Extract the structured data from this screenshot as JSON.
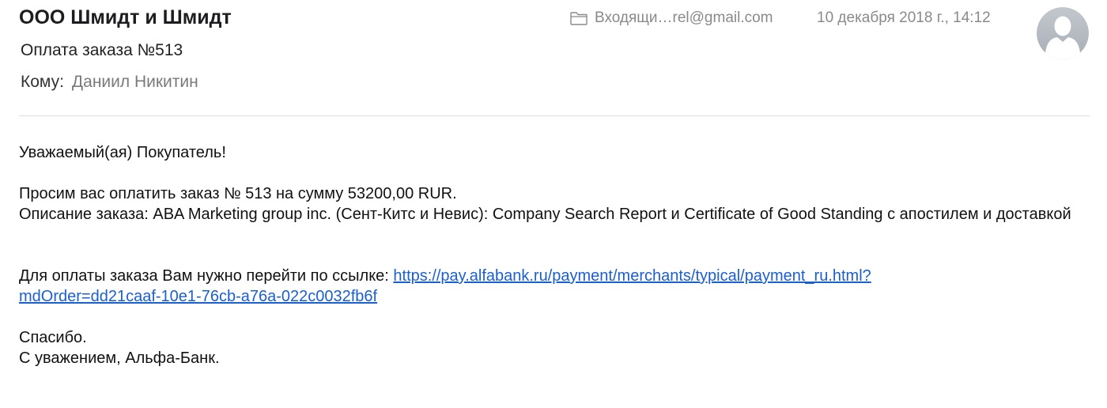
{
  "header": {
    "sender": "ООО Шмидт и Шмидт",
    "subject": "Оплата заказа №513",
    "to_label": "Кому:",
    "to_value": "Даниил Никитин",
    "mailbox": "Входящи…rel@gmail.com",
    "date": "10 декабря 2018 г., 14:12"
  },
  "message": {
    "greeting": "Уважаемый(ая) Покупатель!",
    "request_line": "Просим вас оплатить заказ № 513 на сумму 53200,00 RUR.",
    "description": "Описание заказа: ABA Marketing group inc. (Сент-Китс и Невис): Company Search Report и Certificate of Good Standing с апостилем и доставкой",
    "payment_prefix": "Для оплаты заказа Вам нужно перейти по ссылке: ",
    "payment_link_line1": "https://pay.alfabank.ru/payment/merchants/typical/payment_ru.html?",
    "payment_link_line2": "mdOrder=dd21caaf-10e1-76cb-a76a-022c0032fb6f",
    "thanks": "Спасибо.",
    "signature": "С уважением, Альфа-Банк."
  },
  "icons": {
    "mailbox": "folder-icon",
    "avatar": "person-silhouette-icon"
  },
  "colors": {
    "link": "#1a5fd4",
    "meta_gray": "#8a8a8a",
    "avatar_bg": "#b9bec6"
  }
}
